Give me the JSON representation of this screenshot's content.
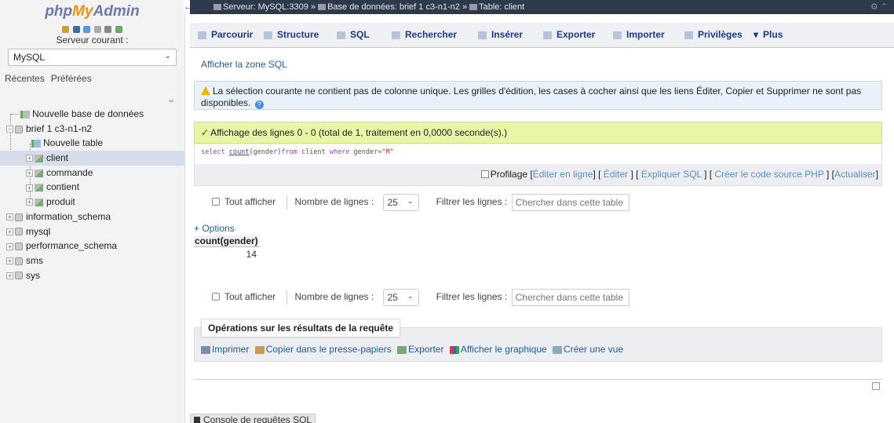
{
  "left": {
    "logo": {
      "php": "php",
      "my": "My",
      "admin": "Admin"
    },
    "server_label": "Serveur courant :",
    "server_value": "MySQL",
    "tabs": [
      "Récentes",
      "Préférées"
    ],
    "tree": {
      "new_db": "Nouvelle base de données",
      "db_main": "brief 1 c3-n1-n2",
      "new_table": "Nouvelle table",
      "tables": [
        "client",
        "commande",
        "contient",
        "produit"
      ],
      "dbs": [
        "information_schema",
        "mysql",
        "performance_schema",
        "sms",
        "sys"
      ]
    }
  },
  "topbar": {
    "server": "Serveur: MySQL:3309",
    "db": "Base de données: brief 1 c3-n1-n2",
    "table": "Table: client",
    "sep": "»"
  },
  "menu": [
    "Parcourir",
    "Structure",
    "SQL",
    "Rechercher",
    "Insérer",
    "Exporter",
    "Importer",
    "Privilèges",
    "Plus"
  ],
  "content": {
    "show_sql": "Afficher la zone SQL",
    "notice": "La sélection courante ne contient pas de colonne unique. Les grilles d'édition, les cases à cocher ainsi que les liens Éditer, Copier et Supprimer ne sont pas disponibles.",
    "success": "Affichage des lignes 0 - 0 (total de 1, traitement en 0,0000 seconde(s).)",
    "sql": {
      "p1": "select",
      "p2": "count",
      "p3": "(gender)",
      "p4": "from",
      "p5": " client ",
      "p6": "where",
      "p7": " gender=",
      "p8": "\"M\""
    },
    "profilage": "Profilage",
    "actions": [
      "Éditer en ligne",
      "Éditer",
      "Expliquer SQL",
      "Créer le code source PHP",
      "Actualiser"
    ],
    "show_all": "Tout afficher",
    "rows_label": "Nombre de lignes :",
    "rows_value": "25",
    "filter_label": "Filtrer les lignes :",
    "filter_placeholder": "Chercher dans cette table",
    "options": "+ Options",
    "col_header": "count(gender)",
    "col_value": "14",
    "ops_title": "Opérations sur les résultats de la requête",
    "ops_links": [
      "Imprimer",
      "Copier dans le presse-papiers",
      "Exporter",
      "Afficher le graphique",
      "Créer une vue"
    ],
    "console": "Console de requêtes SQL"
  }
}
